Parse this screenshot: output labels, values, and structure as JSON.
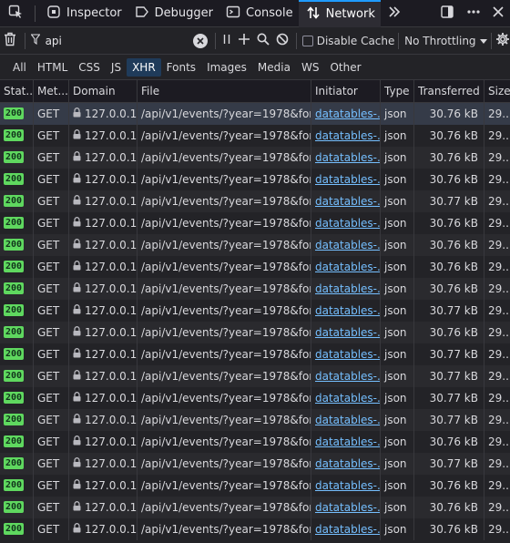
{
  "toolbar": {
    "tabs": [
      {
        "label": "Inspector",
        "icon": "inspector-icon"
      },
      {
        "label": "Debugger",
        "icon": "debugger-icon"
      },
      {
        "label": "Console",
        "icon": "console-icon"
      },
      {
        "label": "Network",
        "icon": "network-icon",
        "active": true
      }
    ]
  },
  "filter": {
    "value": "api",
    "disable_cache_label": "Disable Cache",
    "throttling_label": "No Throttling"
  },
  "types": [
    "All",
    "HTML",
    "CSS",
    "JS",
    "XHR",
    "Fonts",
    "Images",
    "Media",
    "WS",
    "Other"
  ],
  "active_type": "XHR",
  "columns": [
    "Stat...",
    "Met...",
    "Domain",
    "File",
    "Initiator",
    "Type",
    "Transferred",
    "Size"
  ],
  "rows": [
    {
      "status": "200",
      "method": "GET",
      "domain": "127.0.0.1...",
      "file": "/api/v1/events/?year=1978&format=c",
      "initiator": "datatables-...",
      "type": "json",
      "transferred": "30.76 kB",
      "size": "29..."
    },
    {
      "status": "200",
      "method": "GET",
      "domain": "127.0.0.1...",
      "file": "/api/v1/events/?year=1978&format=c",
      "initiator": "datatables-...",
      "type": "json",
      "transferred": "30.76 kB",
      "size": "29..."
    },
    {
      "status": "200",
      "method": "GET",
      "domain": "127.0.0.1...",
      "file": "/api/v1/events/?year=1978&format=c",
      "initiator": "datatables-...",
      "type": "json",
      "transferred": "30.76 kB",
      "size": "29..."
    },
    {
      "status": "200",
      "method": "GET",
      "domain": "127.0.0.1...",
      "file": "/api/v1/events/?year=1978&format=c",
      "initiator": "datatables-...",
      "type": "json",
      "transferred": "30.76 kB",
      "size": "29..."
    },
    {
      "status": "200",
      "method": "GET",
      "domain": "127.0.0.1...",
      "file": "/api/v1/events/?year=1978&format=c",
      "initiator": "datatables-...",
      "type": "json",
      "transferred": "30.77 kB",
      "size": "29..."
    },
    {
      "status": "200",
      "method": "GET",
      "domain": "127.0.0.1...",
      "file": "/api/v1/events/?year=1978&format=c",
      "initiator": "datatables-...",
      "type": "json",
      "transferred": "30.76 kB",
      "size": "29..."
    },
    {
      "status": "200",
      "method": "GET",
      "domain": "127.0.0.1...",
      "file": "/api/v1/events/?year=1978&format=c",
      "initiator": "datatables-...",
      "type": "json",
      "transferred": "30.76 kB",
      "size": "29..."
    },
    {
      "status": "200",
      "method": "GET",
      "domain": "127.0.0.1...",
      "file": "/api/v1/events/?year=1978&format=c",
      "initiator": "datatables-...",
      "type": "json",
      "transferred": "30.76 kB",
      "size": "29..."
    },
    {
      "status": "200",
      "method": "GET",
      "domain": "127.0.0.1...",
      "file": "/api/v1/events/?year=1978&format=c",
      "initiator": "datatables-...",
      "type": "json",
      "transferred": "30.76 kB",
      "size": "29..."
    },
    {
      "status": "200",
      "method": "GET",
      "domain": "127.0.0.1...",
      "file": "/api/v1/events/?year=1978&format=c",
      "initiator": "datatables-...",
      "type": "json",
      "transferred": "30.77 kB",
      "size": "29..."
    },
    {
      "status": "200",
      "method": "GET",
      "domain": "127.0.0.1...",
      "file": "/api/v1/events/?year=1978&format=c",
      "initiator": "datatables-...",
      "type": "json",
      "transferred": "30.76 kB",
      "size": "29..."
    },
    {
      "status": "200",
      "method": "GET",
      "domain": "127.0.0.1...",
      "file": "/api/v1/events/?year=1978&format=c",
      "initiator": "datatables-...",
      "type": "json",
      "transferred": "30.77 kB",
      "size": "29..."
    },
    {
      "status": "200",
      "method": "GET",
      "domain": "127.0.0.1...",
      "file": "/api/v1/events/?year=1978&format=c",
      "initiator": "datatables-...",
      "type": "json",
      "transferred": "30.77 kB",
      "size": "29..."
    },
    {
      "status": "200",
      "method": "GET",
      "domain": "127.0.0.1...",
      "file": "/api/v1/events/?year=1978&format=c",
      "initiator": "datatables-...",
      "type": "json",
      "transferred": "30.77 kB",
      "size": "29..."
    },
    {
      "status": "200",
      "method": "GET",
      "domain": "127.0.0.1...",
      "file": "/api/v1/events/?year=1978&format=c",
      "initiator": "datatables-...",
      "type": "json",
      "transferred": "30.77 kB",
      "size": "29..."
    },
    {
      "status": "200",
      "method": "GET",
      "domain": "127.0.0.1...",
      "file": "/api/v1/events/?year=1978&format=c",
      "initiator": "datatables-...",
      "type": "json",
      "transferred": "30.76 kB",
      "size": "29..."
    },
    {
      "status": "200",
      "method": "GET",
      "domain": "127.0.0.1...",
      "file": "/api/v1/events/?year=1978&format=c",
      "initiator": "datatables-...",
      "type": "json",
      "transferred": "30.77 kB",
      "size": "29..."
    },
    {
      "status": "200",
      "method": "GET",
      "domain": "127.0.0.1...",
      "file": "/api/v1/events/?year=1978&format=c",
      "initiator": "datatables-...",
      "type": "json",
      "transferred": "30.76 kB",
      "size": "29..."
    },
    {
      "status": "200",
      "method": "GET",
      "domain": "127.0.0.1...",
      "file": "/api/v1/events/?year=1978&format=c",
      "initiator": "datatables-...",
      "type": "json",
      "transferred": "30.76 kB",
      "size": "29..."
    },
    {
      "status": "200",
      "method": "GET",
      "domain": "127.0.0.1...",
      "file": "/api/v1/events/?year=1978&format=c",
      "initiator": "datatables-...",
      "type": "json",
      "transferred": "30.76 kB",
      "size": "29..."
    }
  ],
  "colors": {
    "accent": "#1f9bff",
    "status_ok": "#5fd85f",
    "link": "#75bfff",
    "background": "#232327"
  }
}
